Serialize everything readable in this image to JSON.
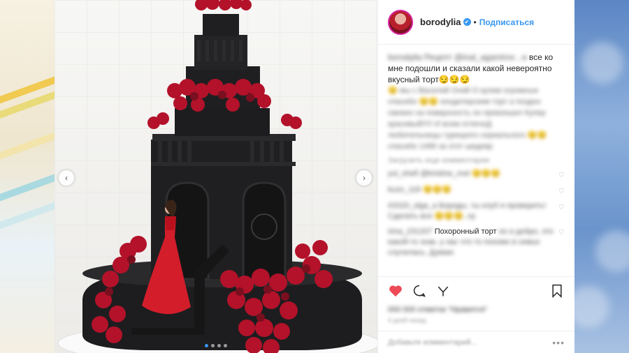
{
  "header": {
    "username": "borodylia",
    "separator": "•",
    "follow_label": "Подписаться"
  },
  "caption": {
    "author": "borodylia",
    "blurred_start": "Рецепт @inal_agamirov , и",
    "visible_text": "все ко мне подошли и сказали какой невероятно вкусный торт😏😏😏",
    "blurred_lines": [
      "😏 мы с Василий Оняй О купим огромные",
      "спасибо 😏😏 кондитерским торт а поздно",
      "свежих на поверхность он превзошел Купер",
      "красивый!!!!! И всем отличоД",
      "любительницы турецкого сериального 😏😏",
      "спасибо 1488 за этот шедевр"
    ]
  },
  "load_more": "Загрузить еще комментарии",
  "comments": [
    {
      "user": "yul_shefi",
      "text": "@kristine_mot 😏😏😏"
    },
    {
      "user": "kuzo_118",
      "text": "😏😏😏"
    },
    {
      "user": "#2020_olga_a",
      "text": "Бороды, ты клуб я проверить! Сделать все 😏😏😏, ну"
    },
    {
      "user": "irina_231207",
      "text": "Похоронный торт",
      "rest": "но и добро, это какой-то знак. у нас что то похоже в семье случилась. Думаю"
    }
  ],
  "likes": "000 000 отметок \"Нравится\"",
  "time_ago": "4 дней назад",
  "add_comment_placeholder": "Добавьте комментарий...",
  "more_label": "•••",
  "icons": {
    "left_arrow": "chevron-left-icon",
    "right_arrow": "chevron-right-icon",
    "like": "heart-icon",
    "comment": "comment-icon",
    "share": "share-icon",
    "save": "bookmark-icon",
    "verified": "verified-badge-icon"
  },
  "colors": {
    "like_red": "#ed4956",
    "link_blue": "#3897f0",
    "cake_black": "#1d1d1f",
    "roses": "#b3122a",
    "dress": "#d31d2b"
  },
  "carousel": {
    "count": 4,
    "active": 1
  }
}
